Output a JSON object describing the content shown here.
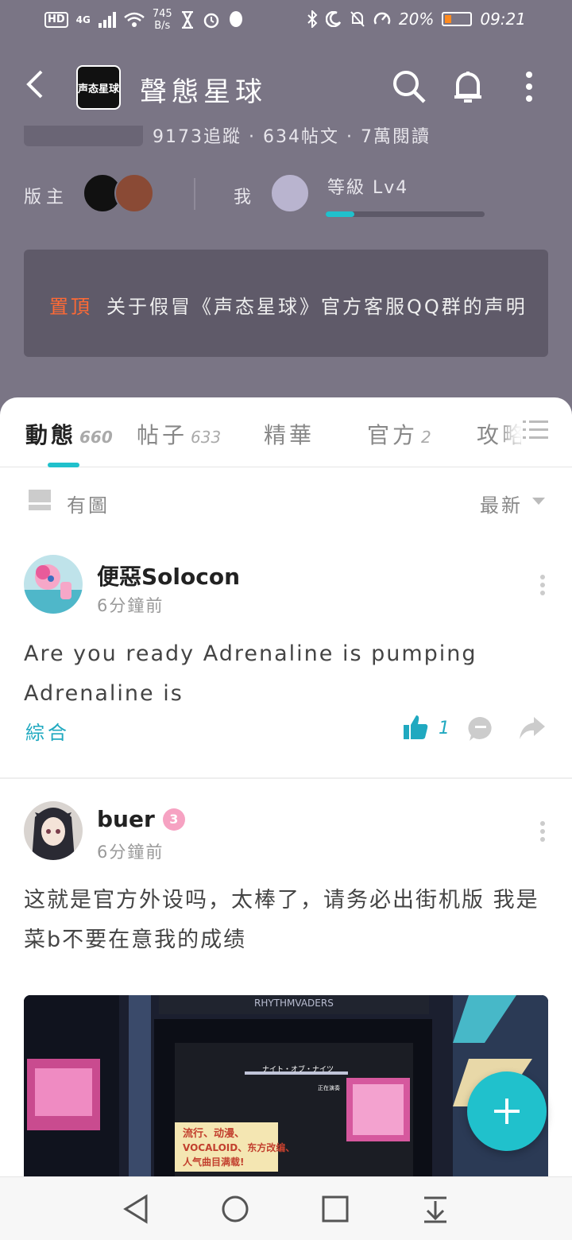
{
  "status_bar": {
    "network": "4G",
    "speed_value": "745",
    "speed_unit": "B/s",
    "battery": "20%",
    "time": "09:21"
  },
  "header": {
    "logo_text": "声态星球",
    "title": "聲態星球"
  },
  "board": {
    "stats_text": "9173追蹤 · 634帖文 · 7萬閱讀",
    "moderator_label": "版主",
    "me_label": "我",
    "level_text": "等級 Lv4",
    "level_progress": 0.18,
    "pinned_tag": "置頂",
    "pinned_text": "关于假冒《声态星球》官方客服QQ群的声明"
  },
  "tabs": [
    {
      "label": "動態",
      "count": "660"
    },
    {
      "label": "帖子",
      "count": "633"
    },
    {
      "label": "精華",
      "count": ""
    },
    {
      "label": "官方",
      "count": "2"
    },
    {
      "label": "攻略",
      "count": ""
    }
  ],
  "filter": {
    "image_label": "有圖",
    "sort_label": "最新"
  },
  "posts": [
    {
      "user": "便惡Solocon",
      "time": "6分鐘前",
      "text": "Are you ready Adrenaline is pumping Adrenaline is",
      "category": "綜合",
      "likes": "1"
    },
    {
      "user": "buer",
      "badge": "3",
      "time": "6分鐘前",
      "text": "这就是官方外设吗，太棒了，请务必出街机版 我是菜b不要在意我的成绩",
      "image_texts": {
        "marquee": "RHYTHMVADERS",
        "song": "ナイト・オブ・ナイツ",
        "status": "正在演奏",
        "promo_line1": "流行、动漫、",
        "promo_line2": "VOCALOID、东方改编、",
        "promo_line3": "人气曲目满载!"
      }
    }
  ],
  "colors": {
    "accent": "#20c1cc",
    "header_bg": "#7a7585",
    "pin_tag": "#ff6a35"
  }
}
